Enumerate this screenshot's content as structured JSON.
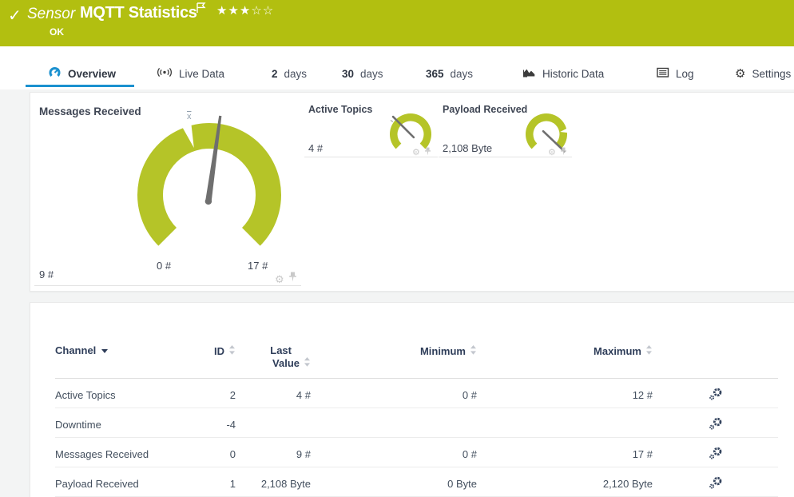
{
  "colors": {
    "header_bg": "#b2bf10",
    "gauge_green": "#b5c428",
    "tab_accent": "#1b91cf",
    "content_bg": "#f3f4f4"
  },
  "header": {
    "kind": "Sensor",
    "title": "MQTT Statistics",
    "status": "OK",
    "rating_stars": "★★★☆☆"
  },
  "tabs": {
    "overview": {
      "label": "Overview"
    },
    "live": {
      "label": "Live Data"
    },
    "d2": {
      "num": "2",
      "unit": "days"
    },
    "d30": {
      "num": "30",
      "unit": "days"
    },
    "d365": {
      "num": "365",
      "unit": "days"
    },
    "historic": {
      "label": "Historic Data"
    },
    "log": {
      "label": "Log"
    },
    "settings": {
      "label": "Settings"
    }
  },
  "gauges": {
    "main": {
      "title": "Messages Received",
      "current": "9 #",
      "scale_min": "0 #",
      "scale_max": "17 #",
      "avg_marker": "x",
      "value": 9,
      "min": 0,
      "max": 17
    },
    "small": [
      {
        "title": "Active Topics",
        "current": "4 #",
        "value": 4,
        "min": 0,
        "max": 12
      },
      {
        "title": "Payload Received",
        "current": "2,108 Byte",
        "value": 2108,
        "min": 0,
        "max": 2120
      }
    ]
  },
  "table": {
    "headers": {
      "channel": "Channel",
      "id": "ID",
      "last1": "Last",
      "last2": "Value",
      "min": "Minimum",
      "max": "Maximum"
    },
    "rows": [
      {
        "channel": "Active Topics",
        "id": "2",
        "last": "4 #",
        "min": "0 #",
        "max": "12 #"
      },
      {
        "channel": "Downtime",
        "id": "-4",
        "last": "",
        "min": "",
        "max": ""
      },
      {
        "channel": "Messages Received",
        "id": "0",
        "last": "9 #",
        "min": "0 #",
        "max": "17 #"
      },
      {
        "channel": "Payload Received",
        "id": "1",
        "last": "2,108 Byte",
        "min": "0 Byte",
        "max": "2,120 Byte"
      }
    ]
  }
}
